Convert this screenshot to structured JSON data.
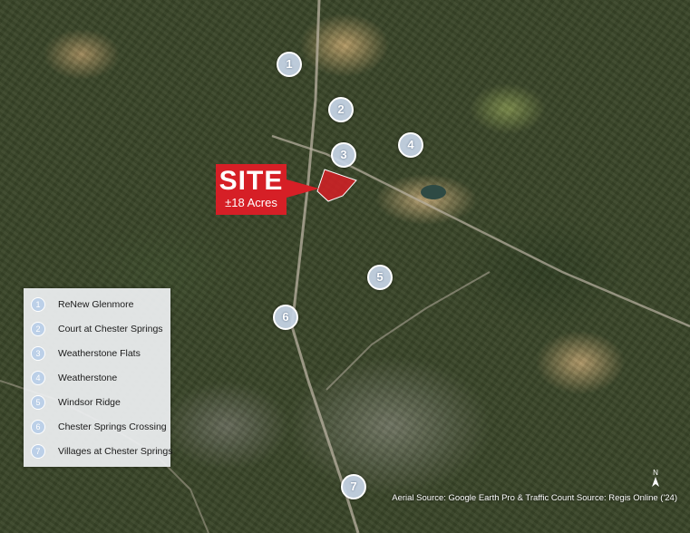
{
  "site": {
    "title": "SITE",
    "acres": "±18 Acres"
  },
  "markers": [
    "1",
    "2",
    "3",
    "4",
    "5",
    "6",
    "7"
  ],
  "legend": [
    {
      "num": "1",
      "label": "ReNew Glenmore"
    },
    {
      "num": "2",
      "label": "Court at Chester Springs"
    },
    {
      "num": "3",
      "label": "Weatherstone Flats"
    },
    {
      "num": "4",
      "label": "Weatherstone"
    },
    {
      "num": "5",
      "label": "Windsor Ridge"
    },
    {
      "num": "6",
      "label": "Chester Springs Crossing"
    },
    {
      "num": "7",
      "label": "Villages at Chester Springs"
    }
  ],
  "source": "Aerial Source: Google Earth Pro & Traffic Count Source: Regis Online ('24)",
  "north": "N",
  "colors": {
    "site_red": "#d61f26",
    "marker_fill": "#c8d6e8",
    "legend_bg": "#eef0f2"
  },
  "icons": {
    "compass": "north-arrow-icon"
  }
}
